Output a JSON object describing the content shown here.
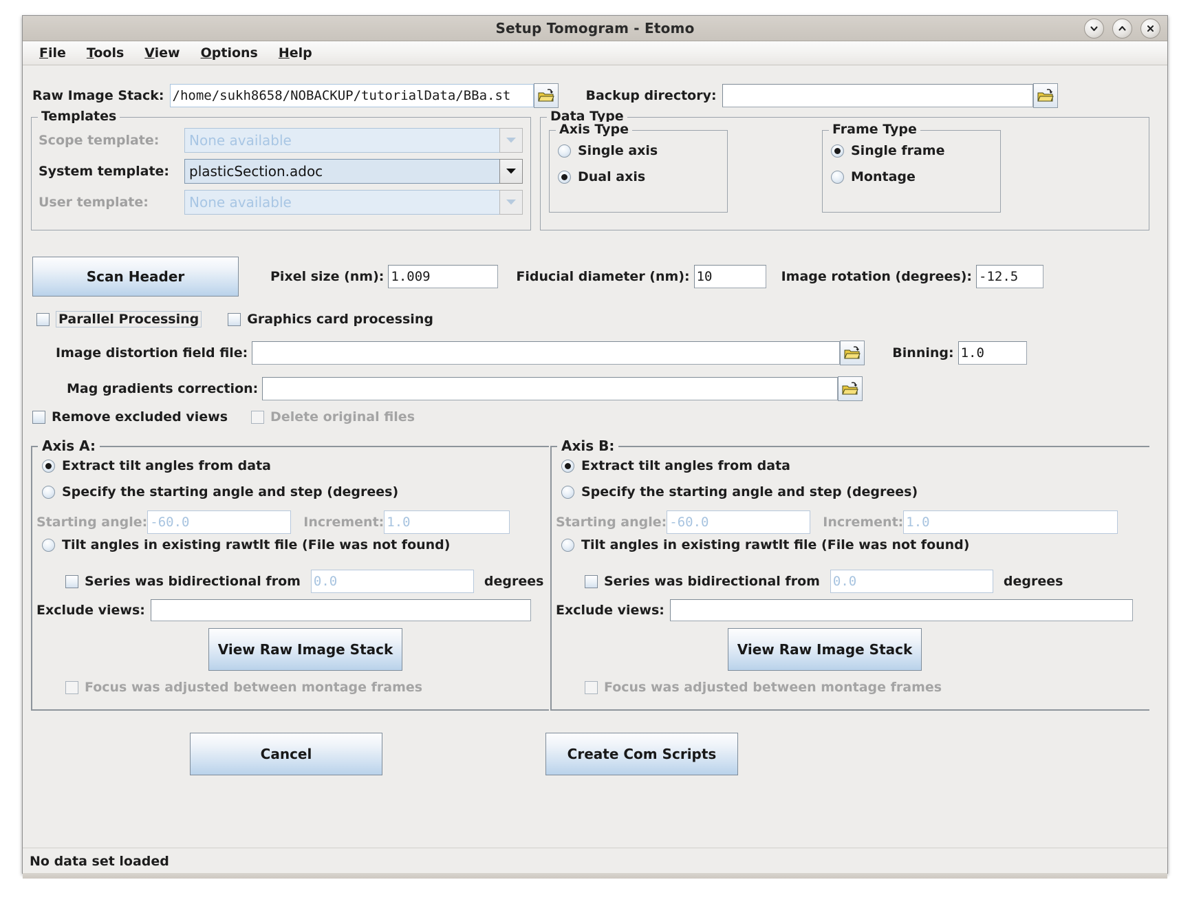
{
  "window": {
    "title": "Setup Tomogram - Etomo",
    "controls": [
      {
        "name": "minimize",
        "glyph": "chevron-down"
      },
      {
        "name": "maximize",
        "glyph": "chevron-up"
      },
      {
        "name": "close",
        "glyph": "x"
      }
    ]
  },
  "menubar": {
    "items": [
      {
        "mnemonic": "F",
        "rest": "ile"
      },
      {
        "mnemonic": "T",
        "rest": "ools"
      },
      {
        "mnemonic": "V",
        "rest": "iew"
      },
      {
        "mnemonic": "O",
        "rest": "ptions"
      },
      {
        "mnemonic": "H",
        "rest": "elp"
      }
    ]
  },
  "top": {
    "raw_stack_label": "Raw Image Stack:",
    "raw_stack_value": "/home/sukh8658/NOBACKUP/tutorialData/BBa.st",
    "backup_label": "Backup directory:",
    "backup_value": ""
  },
  "templates": {
    "legend": "Templates",
    "scope_label": "Scope template:",
    "scope_value": "None available",
    "scope_enabled": false,
    "system_label": "System template:",
    "system_value": "plasticSection.adoc",
    "system_enabled": true,
    "user_label": "User template:",
    "user_value": "None available",
    "user_enabled": false
  },
  "data_type": {
    "legend": "Data Type",
    "axis_type": {
      "legend": "Axis Type",
      "options": [
        {
          "label": "Single axis",
          "selected": false
        },
        {
          "label": "Dual axis",
          "selected": true
        }
      ]
    },
    "frame_type": {
      "legend": "Frame Type",
      "options": [
        {
          "label": "Single frame",
          "selected": true
        },
        {
          "label": "Montage",
          "selected": false
        }
      ]
    }
  },
  "scan": {
    "scan_header_button": "Scan Header",
    "pixel_size_label": "Pixel size (nm):",
    "pixel_size_value": "1.009",
    "fiducial_label": "Fiducial diameter (nm):",
    "fiducial_value": "10",
    "rotation_label": "Image rotation (degrees):",
    "rotation_value": "-12.5"
  },
  "processing": {
    "parallel_label": "Parallel Processing",
    "parallel_checked": false,
    "graphics_label": "Graphics card processing",
    "graphics_checked": false,
    "distortion_label": "Image distortion field file:",
    "distortion_value": "",
    "binning_label": "Binning:",
    "binning_value": "1.0",
    "maggrad_label": "Mag gradients correction:",
    "maggrad_value": "",
    "remove_excluded_label": "Remove excluded views",
    "remove_excluded_checked": false,
    "delete_original_label": "Delete original files",
    "delete_original_checked": false,
    "delete_original_enabled": false
  },
  "axis_a": {
    "legend": "Axis A:",
    "extract_label": "Extract tilt angles from data",
    "extract_selected": true,
    "specify_label": "Specify the starting angle and step (degrees)",
    "specify_selected": false,
    "starting_angle_label": "Starting angle:",
    "starting_angle_value": "-60.0",
    "increment_label": "Increment:",
    "increment_value": "1.0",
    "rawtlt_label": "Tilt angles in existing rawtlt file (File was not found)",
    "rawtlt_selected": false,
    "bidirectional_label": "Series was bidirectional from",
    "bidirectional_checked": false,
    "bidirectional_value": "0.0",
    "degrees_label": "degrees",
    "exclude_label": "Exclude views:",
    "exclude_value": "",
    "view_stack_button": "View Raw Image Stack",
    "focus_label": "Focus was adjusted between montage frames",
    "focus_checked": false,
    "focus_enabled": false
  },
  "axis_b": {
    "legend": "Axis B:",
    "extract_label": "Extract tilt angles from data",
    "extract_selected": true,
    "specify_label": "Specify the starting angle and step (degrees)",
    "specify_selected": false,
    "starting_angle_label": "Starting angle:",
    "starting_angle_value": "-60.0",
    "increment_label": "Increment:",
    "increment_value": "1.0",
    "rawtlt_label": "Tilt angles in existing rawtlt file (File was not found)",
    "rawtlt_selected": false,
    "bidirectional_label": "Series was bidirectional from",
    "bidirectional_checked": false,
    "bidirectional_value": "0.0",
    "degrees_label": "degrees",
    "exclude_label": "Exclude views:",
    "exclude_value": "",
    "view_stack_button": "View Raw Image Stack",
    "focus_label": "Focus was adjusted between montage frames",
    "focus_checked": false,
    "focus_enabled": false
  },
  "footer": {
    "cancel_button": "Cancel",
    "create_button": "Create Com Scripts",
    "status": "No data set loaded"
  },
  "colors": {
    "window_bg": "#eeedeb",
    "titlebar": "#cfcac3",
    "button_accent": "#b9d2ea",
    "disabled_text": "#a8c4e0",
    "folder_icon": "#e8c840"
  }
}
